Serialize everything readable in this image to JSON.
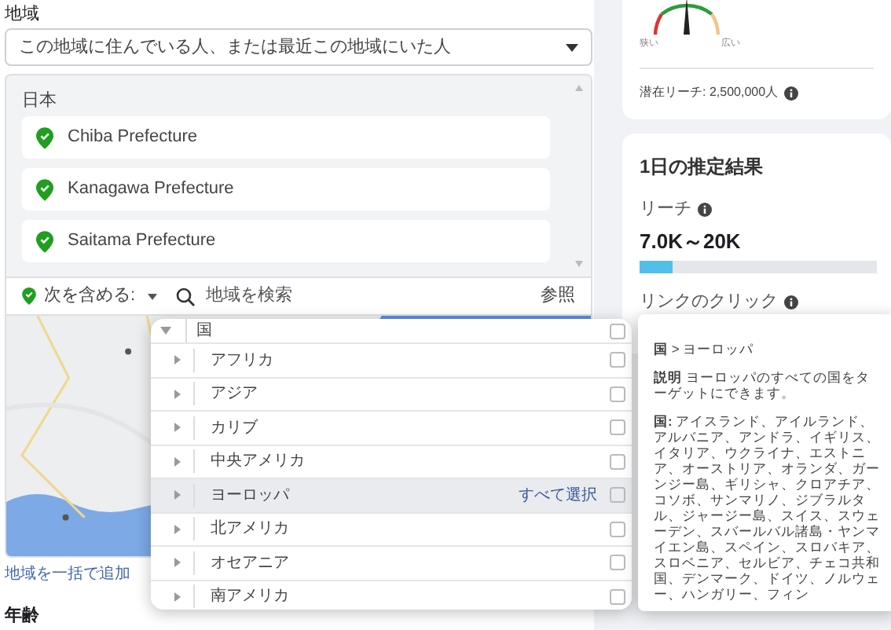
{
  "location": {
    "label": "地域",
    "mode_select": {
      "value": "この地域に住んでいる人、または最近この地域にいた人"
    },
    "country": "日本",
    "places": [
      {
        "name": "Chiba Prefecture"
      },
      {
        "name": "Kanagawa Prefecture"
      },
      {
        "name": "Saitama Prefecture"
      }
    ],
    "include_dropdown": "次を含める:",
    "search": {
      "placeholder": "地域を検索"
    },
    "browse": "参照",
    "bulk_add": "地域を一括で追加"
  },
  "age": {
    "label": "年齢"
  },
  "audience_size": {
    "narrow": "狭い",
    "wide": "広い",
    "potential_reach": "潜在リーチ: 2,500,000人"
  },
  "daily_results": {
    "title": "1日の推定結果",
    "reach_label": "リーチ",
    "reach_value": "7.0K～20K",
    "reach_bar": {
      "level": 0.14
    },
    "clicks_label": "リンクのクリック"
  },
  "browse_menu": {
    "header": "国",
    "expanded": true,
    "header_checked": false,
    "items": [
      {
        "label": "アフリカ",
        "highlighted": false,
        "checked": false
      },
      {
        "label": "アジア",
        "highlighted": false,
        "checked": false
      },
      {
        "label": "カリブ",
        "highlighted": false,
        "checked": false
      },
      {
        "label": "中央アメリカ",
        "highlighted": false,
        "checked": false
      },
      {
        "label": "ヨーロッパ",
        "highlighted": true,
        "checked": false,
        "select_all": "すべて選択"
      },
      {
        "label": "北アメリカ",
        "highlighted": false,
        "checked": false
      },
      {
        "label": "オセアニア",
        "highlighted": false,
        "checked": false
      },
      {
        "label": "南アメリカ",
        "highlighted": false,
        "checked": false
      }
    ]
  },
  "tooltip": {
    "path": "**国** > ヨーロッパ",
    "description": "**説明** ヨーロッパのすべての国をターゲットにできます。",
    "countries": "**国:** アイスランド、アイルランド、アルバニア、アンドラ、イギリス、イタリア、ウクライナ、エストニア、オーストリア、オランダ、ガーンジー島、ギリシャ、クロアチア、コソボ、サンマリノ、ジブラルタル、ジャージー島、スイス、スウェーデン、スバールバル諸島・ヤンマイエン島、スペイン、スロバキア、スロベニア、セルビア、チェコ共和国、デンマーク、ドイツ、ノルウェー、ハンガリー、フィン"
  }
}
